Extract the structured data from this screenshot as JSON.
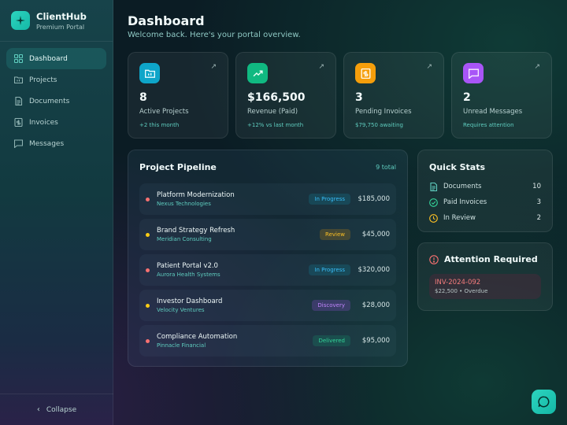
{
  "brand": {
    "title": "ClientHub",
    "subtitle": "Premium Portal"
  },
  "sidebar": {
    "items": [
      {
        "label": "Dashboard",
        "icon": "grid-icon",
        "active": true
      },
      {
        "label": "Projects",
        "icon": "folder-icon",
        "active": false
      },
      {
        "label": "Documents",
        "icon": "document-icon",
        "active": false
      },
      {
        "label": "Invoices",
        "icon": "invoice-icon",
        "active": false
      },
      {
        "label": "Messages",
        "icon": "message-icon",
        "active": false
      }
    ],
    "collapse_label": "Collapse"
  },
  "header": {
    "title": "Dashboard",
    "subtitle": "Welcome back. Here's your portal overview."
  },
  "stats": [
    {
      "value": "8",
      "label": "Active Projects",
      "note": "+2 this month",
      "icon": "folder-icon",
      "color": "#0ea5c9"
    },
    {
      "value": "$166,500",
      "label": "Revenue (Paid)",
      "note": "+12% vs last month",
      "icon": "trending-up-icon",
      "color": "#10b981"
    },
    {
      "value": "3",
      "label": "Pending Invoices",
      "note": "$79,750 awaiting",
      "icon": "invoice-icon",
      "color": "#f59e0b"
    },
    {
      "value": "2",
      "label": "Unread Messages",
      "note": "Requires attention",
      "icon": "message-icon",
      "color": "#a855f7"
    }
  ],
  "pipeline": {
    "title": "Project Pipeline",
    "total": "9 total",
    "rows": [
      {
        "name": "Platform Modernization",
        "client": "Nexus Technologies",
        "status": "In Progress",
        "amount": "$185,000",
        "dot": "#f87171"
      },
      {
        "name": "Brand Strategy Refresh",
        "client": "Meridian Consulting",
        "status": "Review",
        "amount": "$45,000",
        "dot": "#facc15"
      },
      {
        "name": "Patient Portal v2.0",
        "client": "Aurora Health Systems",
        "status": "In Progress",
        "amount": "$320,000",
        "dot": "#f87171"
      },
      {
        "name": "Investor Dashboard",
        "client": "Velocity Ventures",
        "status": "Discovery",
        "amount": "$28,000",
        "dot": "#facc15"
      },
      {
        "name": "Compliance Automation",
        "client": "Pinnacle Financial",
        "status": "Delivered",
        "amount": "$95,000",
        "dot": "#f87171"
      }
    ]
  },
  "quick_stats": {
    "title": "Quick Stats",
    "items": [
      {
        "label": "Documents",
        "count": "10",
        "icon": "document-icon"
      },
      {
        "label": "Paid Invoices",
        "count": "3",
        "icon": "check-circle-icon"
      },
      {
        "label": "In Review",
        "count": "2",
        "icon": "clock-icon"
      }
    ]
  },
  "attention": {
    "title": "Attention Required",
    "invoice_id": "INV-2024-092",
    "meta": "$22,500 • Overdue"
  }
}
